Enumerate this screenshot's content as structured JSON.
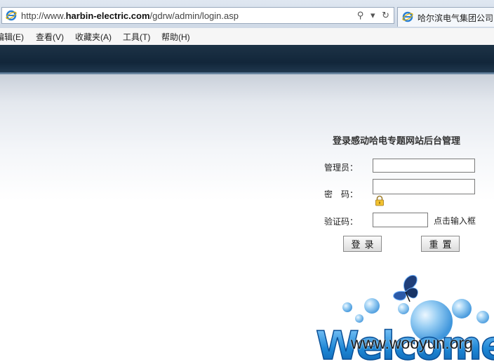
{
  "browser": {
    "url_prefix": "http://www.",
    "url_domain": "harbin-electric.com",
    "url_path": "/gdrw/admin/login.asp",
    "search_glyph": "⚲",
    "dropdown_glyph": "▾",
    "refresh_glyph": "↻",
    "tab_title": "哈尔滨电气集团公司",
    "menu": [
      "编辑(E)",
      "查看(V)",
      "收藏夹(A)",
      "工具(T)",
      "帮助(H)"
    ]
  },
  "login": {
    "title": "登录感动哈电专题网站后台管理",
    "username_label": "管理员：",
    "password_label": "密　码：",
    "captcha_label": "验证码：",
    "captcha_hint": "点击输入框",
    "login_button": "登录",
    "reset_button": "重置",
    "username_value": "",
    "password_value": "",
    "captcha_value": ""
  },
  "decoration": {
    "welcome_text": "Welcome",
    "watermark": "www.wooyun.org"
  },
  "colors": {
    "banner": "#12263a",
    "welcome_blue": "#1e88d6"
  }
}
